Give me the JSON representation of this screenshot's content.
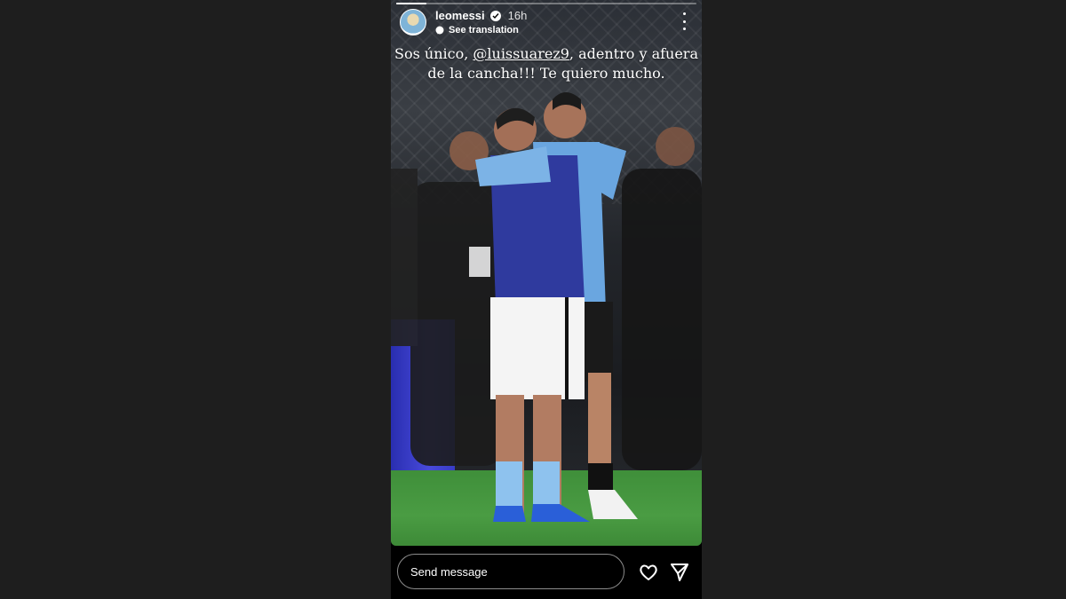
{
  "story": {
    "progress_fraction": 0.1,
    "username": "leomessi",
    "timestamp": "16h",
    "see_translation": "See translation",
    "caption_prefix": "Sos único, ",
    "caption_mention": "@luissuarez9",
    "caption_suffix": ", adentro y afuera de la cancha!!! Te quiero mucho."
  },
  "footer": {
    "message_placeholder": "Send message"
  },
  "icons": {
    "avatar": "profile-avatar",
    "verified": "verified-badge-icon",
    "translate": "translate-icon",
    "more": "more-vertical-icon",
    "like": "heart-icon",
    "share": "send-paper-plane-icon"
  },
  "colors": {
    "page_background": "#1e1e1e",
    "story_background": "#000000",
    "text": "#ffffff"
  }
}
